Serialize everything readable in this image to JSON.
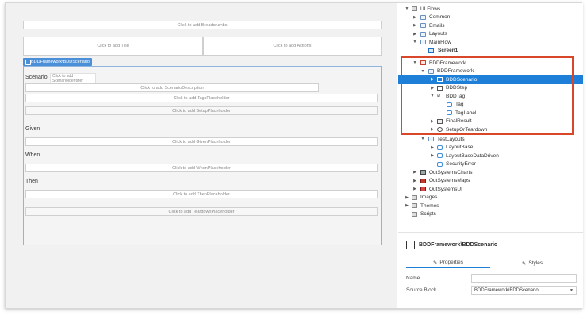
{
  "canvas": {
    "breadcrumbs": "Click to add Breadcrumbs",
    "title": "Click to add Title",
    "actions": "Click to add Actions",
    "block_tag": "BDDFramework\\BDDScenario",
    "scenario_label": "Scenario",
    "scenario_identifier": "Click to add ScenarioIdentifier",
    "scenario_description": "Click to add ScenarioDescription",
    "tags_placeholder": "Click to add TagsPlaceholder",
    "setup_placeholder": "Click to add SetupPlaceholder",
    "given_label": "Given",
    "given_placeholder": "Click to add GivenPlaceholder",
    "when_label": "When",
    "when_placeholder": "Click to add WhenPlaceholder",
    "then_label": "Then",
    "then_placeholder": "Click to add ThenPlaceholder",
    "teardown_placeholder": "Click to add TeardownPlaceholder"
  },
  "tree": {
    "items": [
      {
        "label": "UI Flows",
        "icon": "folder-icon"
      },
      {
        "label": "Common",
        "icon": "flow-icon"
      },
      {
        "label": "Emails",
        "icon": "flow-icon"
      },
      {
        "label": "Layouts",
        "icon": "flow-icon"
      },
      {
        "label": "MainFlow",
        "icon": "flow-icon"
      },
      {
        "label": "Screen1",
        "icon": "screen-icon"
      },
      {
        "label": "BDDFramework",
        "icon": "module-icon"
      },
      {
        "label": "BDDFramework",
        "icon": "flow-icon"
      },
      {
        "label": "BDDScenario",
        "icon": "block-icon"
      },
      {
        "label": "BDDStep",
        "icon": "block-icon"
      },
      {
        "label": "BDDTag",
        "icon": "tag-icon"
      },
      {
        "label": "Tag",
        "icon": "block-icon"
      },
      {
        "label": "TagLabel",
        "icon": "block-icon"
      },
      {
        "label": "FinalResult",
        "icon": "block-icon"
      },
      {
        "label": "SetupOrTeardown",
        "icon": "gear-icon"
      },
      {
        "label": "TestLayouts",
        "icon": "flow-icon"
      },
      {
        "label": "LayoutBase",
        "icon": "block-icon"
      },
      {
        "label": "LayoutBaseDataDriven",
        "icon": "block-icon"
      },
      {
        "label": "SecurityError",
        "icon": "block-icon"
      },
      {
        "label": "OutSystemsCharts",
        "icon": "module-icon"
      },
      {
        "label": "OutSystemsMaps",
        "icon": "module-icon"
      },
      {
        "label": "OutSystemsUI",
        "icon": "module-icon"
      },
      {
        "label": "Images",
        "icon": "folder-icon"
      },
      {
        "label": "Themes",
        "icon": "folder-icon"
      },
      {
        "label": "Scripts",
        "icon": "folder-icon"
      }
    ]
  },
  "properties": {
    "header": "BDDFramework\\BDDScenario",
    "tab_properties": "Properties",
    "tab_styles": "Styles",
    "name_label": "Name",
    "name_value": "",
    "source_block_label": "Source Block",
    "source_block_value": "BDDFramework\\BDDScenario"
  },
  "colors": {
    "selection": "#1e7fd8",
    "highlight_box": "#d9472b",
    "block_tag": "#4a8fd8"
  }
}
